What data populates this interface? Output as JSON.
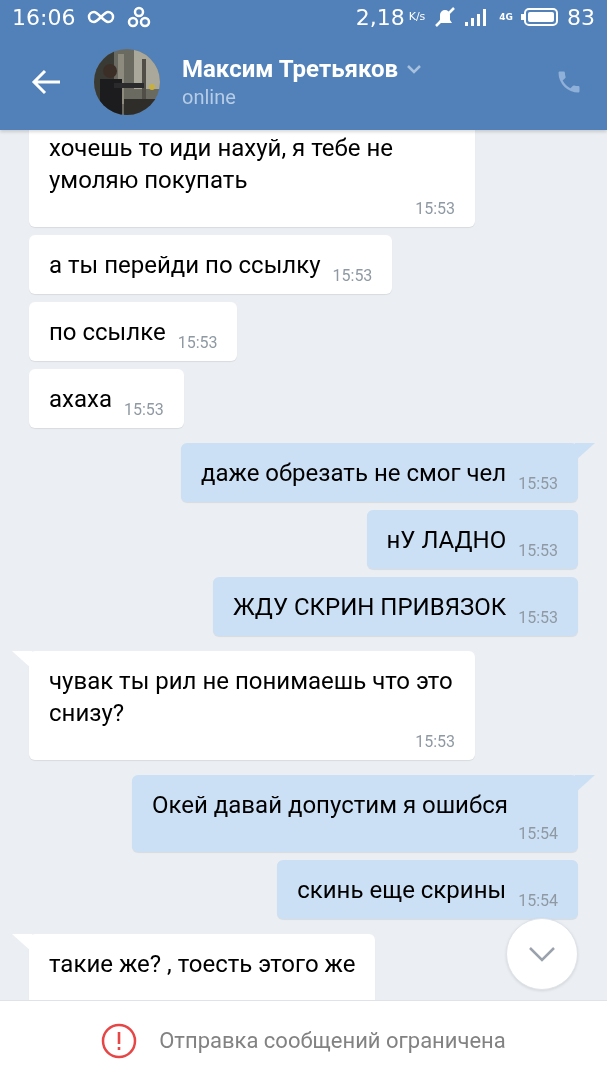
{
  "status_bar": {
    "time": "16:06",
    "speed": "2,18",
    "speed_unit": "K/s",
    "network": "4G",
    "battery": "83"
  },
  "header": {
    "name": "Максим Третьяков",
    "status": "online"
  },
  "messages": [
    {
      "kind": "in",
      "text": "хочешь то иди нахуй, я тебе не умоляю покупать",
      "time": "15:53",
      "tail": false
    },
    {
      "kind": "in",
      "text": "а ты перейди по ссылку",
      "time": "15:53",
      "tail": false
    },
    {
      "kind": "in",
      "text": "по ссылке",
      "time": "15:53",
      "tail": false
    },
    {
      "kind": "in",
      "text": "ахаха",
      "time": "15:53",
      "tail": false
    },
    {
      "kind": "out",
      "text": "даже обрезать не смог чел",
      "time": "15:53",
      "tail": true
    },
    {
      "kind": "out",
      "text": "нУ ЛАДНО",
      "time": "15:53",
      "tail": false
    },
    {
      "kind": "out",
      "text": "ЖДУ СКРИН ПРИВЯЗОК",
      "time": "15:53",
      "tail": false
    },
    {
      "kind": "in",
      "text": "чувак ты рил не понимаешь что это снизу?",
      "time": "15:53",
      "tail": true
    },
    {
      "kind": "out",
      "text": "Окей давай допустим я ошибся",
      "time": "15:54",
      "tail": true
    },
    {
      "kind": "out",
      "text": "скинь еще скрины",
      "time": "15:54",
      "tail": false
    },
    {
      "kind": "in",
      "text": "такие же? , тоесть этого же",
      "tail": true
    }
  ],
  "footer": {
    "notice": "Отправка сообщений ограничена"
  }
}
